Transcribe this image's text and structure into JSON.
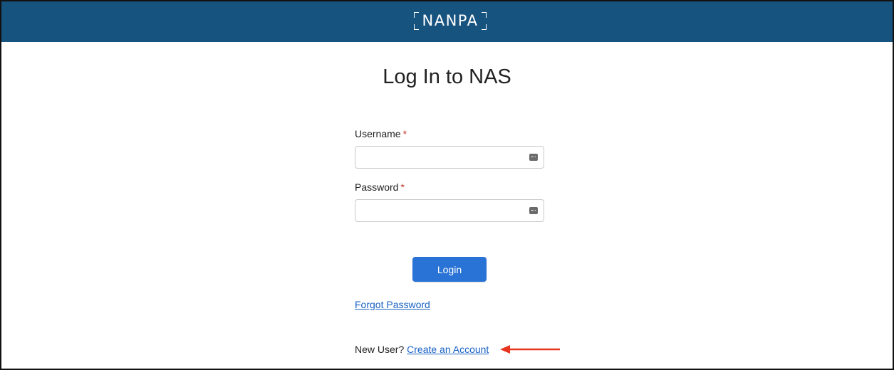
{
  "header": {
    "logo_text": "NANPA",
    "background_color": "#17537f"
  },
  "page": {
    "title": "Log In to NAS"
  },
  "form": {
    "username_label": "Username",
    "username_value": "",
    "password_label": "Password",
    "password_value": "",
    "required_marker": "*",
    "field_icon": "key-icon",
    "login_label": "Login"
  },
  "links": {
    "forgot_password": "Forgot Password",
    "new_user_prompt": "New User?",
    "create_account": "Create an Account"
  },
  "annotation": {
    "arrow_icon": "arrow-left-icon",
    "arrow_color": "#e8331f"
  },
  "colors": {
    "accent": "#2a73d6",
    "link": "#1a62c4",
    "required": "#c23934"
  }
}
